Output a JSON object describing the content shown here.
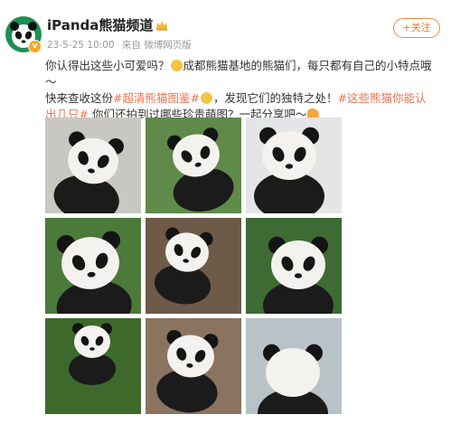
{
  "header": {
    "username": "iPanda熊猫频道",
    "timestamp": "23-5-25 10:00",
    "source": "来自 微博网页版",
    "follow_label": "+关注",
    "avatar_icon": "panda-avatar-icon",
    "verified_icon": "verified-badge-icon"
  },
  "post": {
    "line1_a": "你认得出这些小可爱吗？",
    "line1_b": "成都熊猫基地的熊猫们，每只都有自己的小特点哦～",
    "line2_a": "快来查收这份",
    "tag1": "#超清熊猫图鉴#",
    "line2_b": "，发现它们的独特之处！",
    "tag2": "#这些熊猫你能认出几只#",
    "line3": " 你们还拍到过哪些珍贵萌图？一起分享吧～"
  },
  "colors": {
    "accent": "#eb7350",
    "follow": "#f07a2c",
    "avatar_bg": "#1f8f55"
  },
  "photos": [
    {
      "name": "panda-photo-1",
      "bg": "#c9c7c2"
    },
    {
      "name": "panda-photo-2",
      "bg": "#5f8a4a"
    },
    {
      "name": "panda-photo-3",
      "bg": "#e3e5e6"
    },
    {
      "name": "panda-photo-4",
      "bg": "#4c7a3a"
    },
    {
      "name": "panda-photo-5",
      "bg": "#6e5a48"
    },
    {
      "name": "panda-photo-6",
      "bg": "#3e6b33"
    },
    {
      "name": "panda-photo-7",
      "bg": "#3d6a2c"
    },
    {
      "name": "panda-photo-8",
      "bg": "#8a7460"
    },
    {
      "name": "panda-photo-9",
      "bg": "#b9c2c7"
    }
  ]
}
